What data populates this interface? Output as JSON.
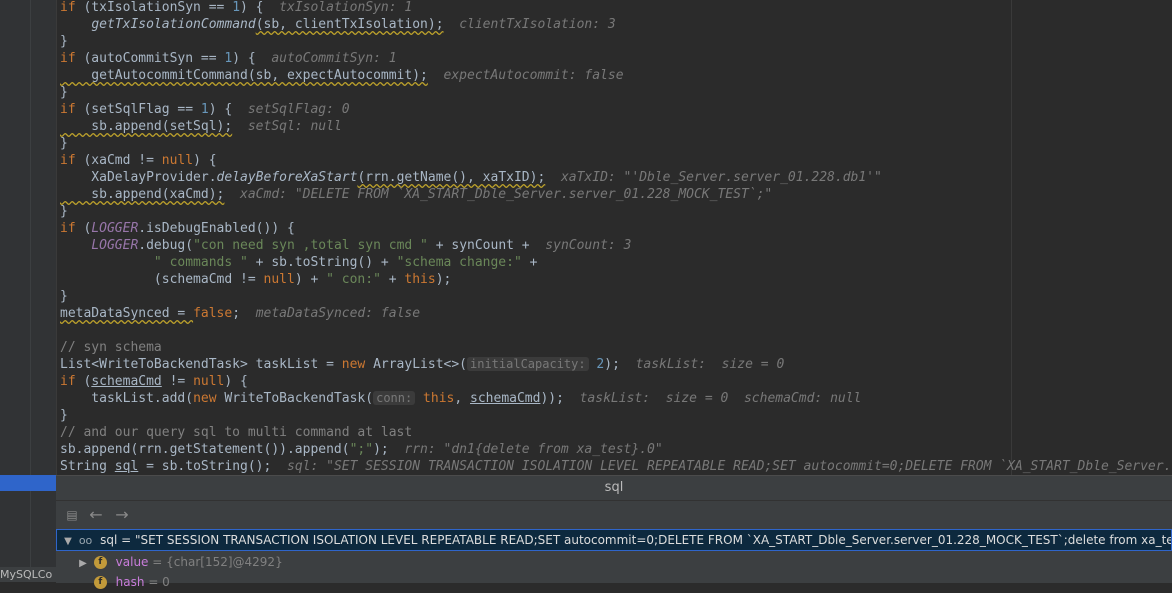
{
  "editor": {
    "lines": [
      [
        {
          "t": "if",
          "c": "kw"
        },
        {
          "t": " (txIsolationSyn == "
        },
        {
          "t": "1",
          "c": "num"
        },
        {
          "t": ") {  "
        },
        {
          "t": "txIsolationSyn: 1",
          "c": "hint"
        }
      ],
      [
        {
          "t": "    "
        },
        {
          "t": "getTxIsolationCommand",
          "c": "fn-i"
        },
        {
          "t": "(sb, clientTxIsolation);",
          "c": "warn"
        },
        {
          "t": "  "
        },
        {
          "t": "clientTxIsolation: 3",
          "c": "hint"
        }
      ],
      [
        {
          "t": "}"
        }
      ],
      [
        {
          "t": "if",
          "c": "kw"
        },
        {
          "t": " (autoCommitSyn == "
        },
        {
          "t": "1",
          "c": "num"
        },
        {
          "t": ") {  "
        },
        {
          "t": "autoCommitSyn: 1",
          "c": "hint"
        }
      ],
      [
        {
          "t": "    getAutocommitCommand(sb, expectAutocommit);",
          "c": "warn"
        },
        {
          "t": "  "
        },
        {
          "t": "expectAutocommit: false",
          "c": "hint"
        }
      ],
      [
        {
          "t": "}"
        }
      ],
      [
        {
          "t": "if",
          "c": "kw"
        },
        {
          "t": " (setSqlFlag == "
        },
        {
          "t": "1",
          "c": "num"
        },
        {
          "t": ") {  "
        },
        {
          "t": "setSqlFlag: 0",
          "c": "hint"
        }
      ],
      [
        {
          "t": "    sb.append(setSql);",
          "c": "warn"
        },
        {
          "t": "  "
        },
        {
          "t": "setSql: null",
          "c": "hint"
        }
      ],
      [
        {
          "t": "}"
        }
      ],
      [
        {
          "t": "if",
          "c": "kw"
        },
        {
          "t": " (xaCmd != "
        },
        {
          "t": "null",
          "c": "kw"
        },
        {
          "t": ") {"
        }
      ],
      [
        {
          "t": "    XaDelayProvider."
        },
        {
          "t": "delayBeforeXaStart",
          "c": "fn-i"
        },
        {
          "t": "(rrn.getName(), xaTxID);",
          "c": "warn"
        },
        {
          "t": "  "
        },
        {
          "t": "xaTxID: \"'Dble_Server.server_01.228.db1'\"",
          "c": "hint"
        }
      ],
      [
        {
          "t": "    sb.append(xaCmd);",
          "c": "warn"
        },
        {
          "t": "  "
        },
        {
          "t": "xaCmd: \"DELETE FROM `XA_START_Dble_Server.server_01.228_MOCK_TEST`;\"",
          "c": "hint"
        }
      ],
      [
        {
          "t": "}"
        }
      ],
      [
        {
          "t": "if",
          "c": "kw"
        },
        {
          "t": " ("
        },
        {
          "t": "LOGGER",
          "c": "stat"
        },
        {
          "t": ".isDebugEnabled()) {"
        }
      ],
      [
        {
          "t": "    "
        },
        {
          "t": "LOGGER",
          "c": "stat"
        },
        {
          "t": ".debug("
        },
        {
          "t": "\"con need syn ,total syn cmd \"",
          "c": "str"
        },
        {
          "t": " + synCount +"
        },
        {
          "t": "  "
        },
        {
          "t": "synCount: 3",
          "c": "hint"
        }
      ],
      [
        {
          "t": "            "
        },
        {
          "t": "\" commands \"",
          "c": "str"
        },
        {
          "t": " + sb.toString() + "
        },
        {
          "t": "\"schema change:\"",
          "c": "str"
        },
        {
          "t": " +"
        }
      ],
      [
        {
          "t": "            (schemaCmd != "
        },
        {
          "t": "null",
          "c": "kw"
        },
        {
          "t": ") + "
        },
        {
          "t": "\" con:\"",
          "c": "str"
        },
        {
          "t": " + "
        },
        {
          "t": "this",
          "c": "kw"
        },
        {
          "t": ");"
        }
      ],
      [
        {
          "t": "}"
        }
      ],
      [
        {
          "t": "metaDataSynced = ",
          "c": "warn"
        },
        {
          "t": "false",
          "c": "kw"
        },
        {
          "t": ";"
        },
        {
          "t": "  "
        },
        {
          "t": "metaDataSynced: false",
          "c": "hint"
        }
      ],
      [
        {
          "t": ""
        }
      ],
      [
        {
          "t": "// syn schema",
          "c": "cmt"
        }
      ],
      [
        {
          "t": "List<WriteToBackendTask> taskList = "
        },
        {
          "t": "new",
          "c": "kw"
        },
        {
          "t": " ArrayList<>("
        },
        {
          "t": "initialCapacity:",
          "c": "param"
        },
        {
          "t": " "
        },
        {
          "t": "2",
          "c": "num"
        },
        {
          "t": ");  "
        },
        {
          "t": "taskList:  size = 0",
          "c": "hint"
        }
      ],
      [
        {
          "t": "if",
          "c": "kw"
        },
        {
          "t": " ("
        },
        {
          "t": "schemaCmd",
          "c": "under"
        },
        {
          "t": " != "
        },
        {
          "t": "null",
          "c": "kw"
        },
        {
          "t": ") {"
        }
      ],
      [
        {
          "t": "    taskList.add("
        },
        {
          "t": "new",
          "c": "kw"
        },
        {
          "t": " WriteToBackendTask("
        },
        {
          "t": "conn:",
          "c": "param"
        },
        {
          "t": " "
        },
        {
          "t": "this",
          "c": "kw"
        },
        {
          "t": ", "
        },
        {
          "t": "schemaCmd",
          "c": "under"
        },
        {
          "t": "));  "
        },
        {
          "t": "taskList:  size = 0  schemaCmd: null",
          "c": "hint"
        }
      ],
      [
        {
          "t": "}"
        }
      ],
      [
        {
          "t": "// and our query sql to multi command at last",
          "c": "cmt"
        }
      ],
      [
        {
          "t": "sb.append(rrn.getStatement()).append("
        },
        {
          "t": "\";\"",
          "c": "str"
        },
        {
          "t": ");  "
        },
        {
          "t": "rrn: \"dn1{delete from xa_test}.0\"",
          "c": "hint"
        }
      ],
      [
        {
          "t": "String "
        },
        {
          "t": "sql",
          "c": "under"
        },
        {
          "t": " = sb.toString();  "
        },
        {
          "t": "sql: \"SET SESSION TRANSACTION ISOLATION LEVEL REPEATABLE READ;SET autocommit=0;DELETE FROM `XA_START_Dble_Server.server_01.228_MOCK_TEST`;delete from xa_test;\"",
          "c": "hint"
        }
      ]
    ]
  },
  "panel": {
    "title": "sql",
    "back_icon": "←",
    "forward_icon": "→",
    "selected_row": {
      "icon": "oo",
      "name": "sql",
      "value": "= \"SET SESSION TRANSACTION ISOLATION LEVEL REPEATABLE READ;SET autocommit=0;DELETE FROM `XA_START_Dble_Server.server_01.228_MOCK_TEST`;delete from xa_test;\""
    },
    "rows": [
      {
        "badge": "f",
        "name": "value",
        "value": "= {char[152]@4292}"
      },
      {
        "badge": "f",
        "name": "hash",
        "value": "= 0"
      }
    ]
  },
  "sidebar_tab": "MySQLCo"
}
